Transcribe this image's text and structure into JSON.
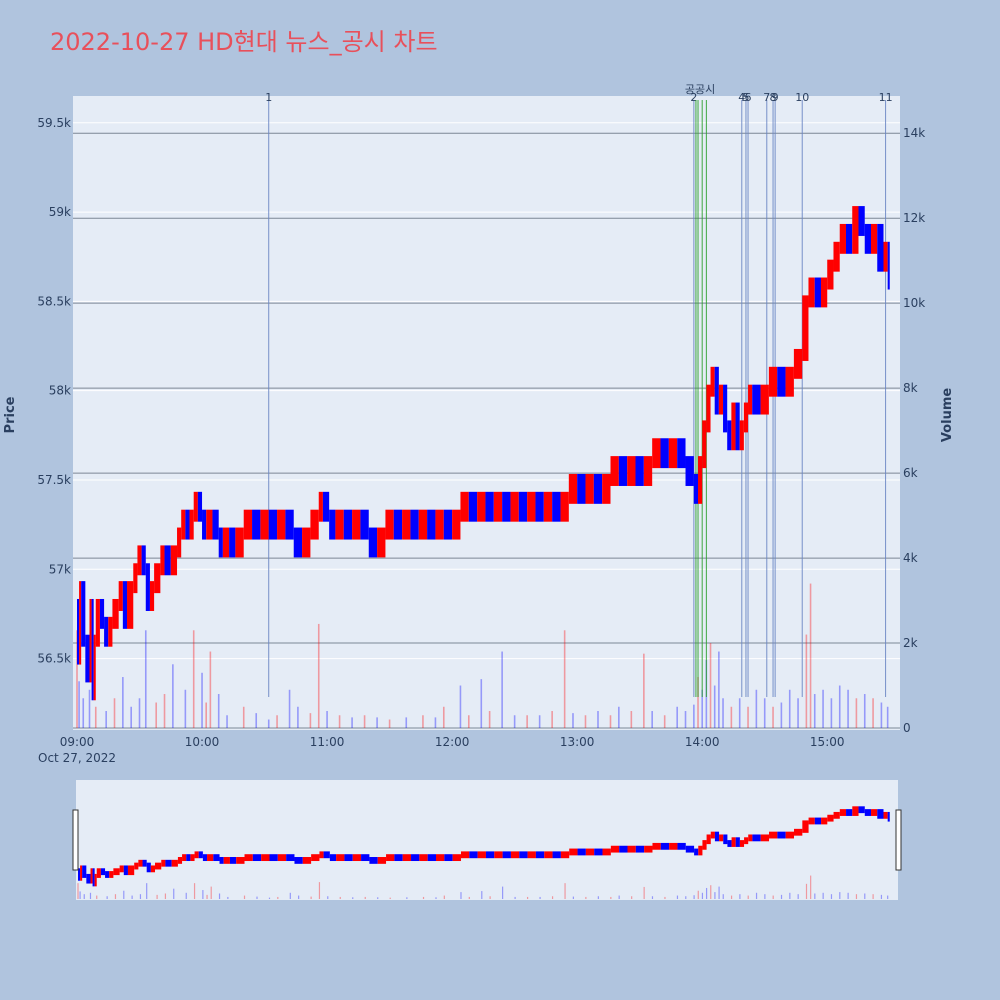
{
  "title": "2022-10-27 HD현대 뉴스_공시 차트",
  "colors": {
    "up": "#ff0000",
    "down": "#0000ff",
    "news_line": "#6a86c4",
    "disclosure_line": "#2ca02c",
    "background": "#b0c4de",
    "plot_bg": "#e5ecf6"
  },
  "chart_data": {
    "type": "candlestick",
    "yaxis_title": "Price",
    "y2axis_title": "Volume",
    "price_range": [
      56100,
      59650
    ],
    "volume_range": [
      0,
      14500
    ],
    "price_ticks": [
      {
        "v": 56500,
        "label": "56.5k"
      },
      {
        "v": 57000,
        "label": "57k"
      },
      {
        "v": 57500,
        "label": "57.5k"
      },
      {
        "v": 58000,
        "label": "58k"
      },
      {
        "v": 58500,
        "label": "58.5k"
      },
      {
        "v": 59000,
        "label": "59k"
      },
      {
        "v": 59500,
        "label": "59.5k"
      }
    ],
    "volume_ticks": [
      {
        "v": 0,
        "label": "0"
      },
      {
        "v": 2000,
        "label": "2k"
      },
      {
        "v": 4000,
        "label": "4k"
      },
      {
        "v": 6000,
        "label": "6k"
      },
      {
        "v": 8000,
        "label": "8k"
      },
      {
        "v": 10000,
        "label": "10k"
      },
      {
        "v": 12000,
        "label": "12k"
      },
      {
        "v": 14000,
        "label": "14k"
      }
    ],
    "x_ticks": [
      {
        "t": 0,
        "label": "09:00"
      },
      {
        "t": 60,
        "label": "10:00"
      },
      {
        "t": 120,
        "label": "11:00"
      },
      {
        "t": 180,
        "label": "12:00"
      },
      {
        "t": 240,
        "label": "13:00"
      },
      {
        "t": 300,
        "label": "14:00"
      },
      {
        "t": 360,
        "label": "15:00"
      }
    ],
    "x_range_minutes": [
      0,
      393
    ],
    "date_label": "Oct 27, 2022",
    "price_path": [
      [
        0,
        56800
      ],
      [
        1,
        56500
      ],
      [
        2,
        56900
      ],
      [
        4,
        56600
      ],
      [
        6,
        56400
      ],
      [
        7,
        56800
      ],
      [
        8,
        56300
      ],
      [
        9,
        56600
      ],
      [
        11,
        56800
      ],
      [
        13,
        56700
      ],
      [
        15,
        56600
      ],
      [
        17,
        56700
      ],
      [
        20,
        56800
      ],
      [
        22,
        56900
      ],
      [
        24,
        56700
      ],
      [
        27,
        56900
      ],
      [
        29,
        57000
      ],
      [
        31,
        57100
      ],
      [
        33,
        57000
      ],
      [
        35,
        56800
      ],
      [
        37,
        56900
      ],
      [
        40,
        57000
      ],
      [
        42,
        57100
      ],
      [
        45,
        57000
      ],
      [
        48,
        57100
      ],
      [
        50,
        57200
      ],
      [
        52,
        57300
      ],
      [
        54,
        57200
      ],
      [
        56,
        57300
      ],
      [
        58,
        57400
      ],
      [
        60,
        57300
      ],
      [
        62,
        57200
      ],
      [
        65,
        57300
      ],
      [
        68,
        57200
      ],
      [
        70,
        57100
      ],
      [
        73,
        57200
      ],
      [
        76,
        57100
      ],
      [
        80,
        57200
      ],
      [
        84,
        57300
      ],
      [
        88,
        57200
      ],
      [
        92,
        57300
      ],
      [
        96,
        57200
      ],
      [
        100,
        57300
      ],
      [
        104,
        57200
      ],
      [
        108,
        57100
      ],
      [
        112,
        57200
      ],
      [
        116,
        57300
      ],
      [
        118,
        57400
      ],
      [
        121,
        57300
      ],
      [
        124,
        57200
      ],
      [
        128,
        57300
      ],
      [
        132,
        57200
      ],
      [
        136,
        57300
      ],
      [
        140,
        57200
      ],
      [
        144,
        57100
      ],
      [
        148,
        57200
      ],
      [
        152,
        57300
      ],
      [
        156,
        57200
      ],
      [
        160,
        57300
      ],
      [
        164,
        57200
      ],
      [
        168,
        57300
      ],
      [
        172,
        57200
      ],
      [
        176,
        57300
      ],
      [
        180,
        57200
      ],
      [
        184,
        57300
      ],
      [
        188,
        57400
      ],
      [
        192,
        57300
      ],
      [
        196,
        57400
      ],
      [
        200,
        57300
      ],
      [
        204,
        57400
      ],
      [
        208,
        57300
      ],
      [
        212,
        57400
      ],
      [
        216,
        57300
      ],
      [
        220,
        57400
      ],
      [
        224,
        57300
      ],
      [
        228,
        57400
      ],
      [
        232,
        57300
      ],
      [
        236,
        57400
      ],
      [
        240,
        57500
      ],
      [
        244,
        57400
      ],
      [
        248,
        57500
      ],
      [
        252,
        57400
      ],
      [
        256,
        57500
      ],
      [
        260,
        57600
      ],
      [
        264,
        57500
      ],
      [
        268,
        57600
      ],
      [
        272,
        57500
      ],
      [
        276,
        57600
      ],
      [
        280,
        57700
      ],
      [
        284,
        57600
      ],
      [
        288,
        57700
      ],
      [
        292,
        57600
      ],
      [
        296,
        57500
      ],
      [
        298,
        57400
      ],
      [
        300,
        57600
      ],
      [
        302,
        57800
      ],
      [
        304,
        58000
      ],
      [
        306,
        58100
      ],
      [
        308,
        57900
      ],
      [
        310,
        58000
      ],
      [
        312,
        57800
      ],
      [
        314,
        57700
      ],
      [
        316,
        57900
      ],
      [
        318,
        57700
      ],
      [
        320,
        57800
      ],
      [
        322,
        57900
      ],
      [
        324,
        58000
      ],
      [
        328,
        57900
      ],
      [
        332,
        58000
      ],
      [
        336,
        58100
      ],
      [
        340,
        58000
      ],
      [
        344,
        58100
      ],
      [
        348,
        58200
      ],
      [
        351,
        58500
      ],
      [
        354,
        58600
      ],
      [
        357,
        58500
      ],
      [
        360,
        58600
      ],
      [
        363,
        58700
      ],
      [
        366,
        58800
      ],
      [
        369,
        58900
      ],
      [
        372,
        58800
      ],
      [
        375,
        59000
      ],
      [
        378,
        58900
      ],
      [
        381,
        58800
      ],
      [
        384,
        58900
      ],
      [
        387,
        58700
      ],
      [
        389,
        58800
      ],
      [
        390,
        58600
      ]
    ],
    "volume_bars": [
      [
        0,
        2300,
        "up"
      ],
      [
        1,
        1100,
        "down"
      ],
      [
        3,
        700,
        "down"
      ],
      [
        6,
        900,
        "down"
      ],
      [
        9,
        500,
        "up"
      ],
      [
        14,
        400,
        "down"
      ],
      [
        18,
        700,
        "up"
      ],
      [
        22,
        1200,
        "down"
      ],
      [
        26,
        500,
        "down"
      ],
      [
        30,
        700,
        "down"
      ],
      [
        33,
        2300,
        "down"
      ],
      [
        38,
        600,
        "up"
      ],
      [
        42,
        800,
        "up"
      ],
      [
        46,
        1500,
        "down"
      ],
      [
        52,
        900,
        "down"
      ],
      [
        56,
        2300,
        "up"
      ],
      [
        60,
        1300,
        "down"
      ],
      [
        62,
        600,
        "up"
      ],
      [
        64,
        1800,
        "up"
      ],
      [
        68,
        800,
        "down"
      ],
      [
        72,
        300,
        "down"
      ],
      [
        80,
        500,
        "up"
      ],
      [
        86,
        350,
        "down"
      ],
      [
        92,
        200,
        "down"
      ],
      [
        96,
        300,
        "up"
      ],
      [
        102,
        900,
        "down"
      ],
      [
        106,
        500,
        "down"
      ],
      [
        112,
        350,
        "up"
      ],
      [
        116,
        2450,
        "up"
      ],
      [
        120,
        400,
        "down"
      ],
      [
        126,
        300,
        "up"
      ],
      [
        132,
        250,
        "down"
      ],
      [
        138,
        300,
        "up"
      ],
      [
        144,
        250,
        "down"
      ],
      [
        150,
        200,
        "up"
      ],
      [
        158,
        250,
        "down"
      ],
      [
        166,
        300,
        "up"
      ],
      [
        172,
        250,
        "down"
      ],
      [
        176,
        500,
        "up"
      ],
      [
        184,
        1000,
        "down"
      ],
      [
        188,
        300,
        "up"
      ],
      [
        194,
        1150,
        "down"
      ],
      [
        198,
        400,
        "up"
      ],
      [
        204,
        1800,
        "down"
      ],
      [
        210,
        300,
        "down"
      ],
      [
        216,
        300,
        "up"
      ],
      [
        222,
        300,
        "down"
      ],
      [
        228,
        400,
        "up"
      ],
      [
        234,
        2300,
        "up"
      ],
      [
        238,
        350,
        "down"
      ],
      [
        244,
        300,
        "up"
      ],
      [
        250,
        400,
        "down"
      ],
      [
        256,
        300,
        "up"
      ],
      [
        260,
        500,
        "down"
      ],
      [
        266,
        400,
        "up"
      ],
      [
        272,
        1750,
        "up"
      ],
      [
        276,
        400,
        "down"
      ],
      [
        282,
        300,
        "up"
      ],
      [
        288,
        500,
        "down"
      ],
      [
        292,
        400,
        "down"
      ],
      [
        296,
        550,
        "down"
      ],
      [
        298,
        1200,
        "up"
      ],
      [
        300,
        900,
        "down"
      ],
      [
        302,
        1600,
        "down"
      ],
      [
        304,
        2000,
        "up"
      ],
      [
        306,
        1000,
        "down"
      ],
      [
        308,
        1800,
        "down"
      ],
      [
        310,
        700,
        "down"
      ],
      [
        314,
        500,
        "up"
      ],
      [
        318,
        700,
        "down"
      ],
      [
        322,
        500,
        "up"
      ],
      [
        326,
        900,
        "down"
      ],
      [
        330,
        700,
        "down"
      ],
      [
        334,
        500,
        "up"
      ],
      [
        338,
        600,
        "down"
      ],
      [
        342,
        900,
        "down"
      ],
      [
        346,
        700,
        "down"
      ],
      [
        350,
        2200,
        "up"
      ],
      [
        352,
        3400,
        "up"
      ],
      [
        354,
        800,
        "down"
      ],
      [
        358,
        900,
        "down"
      ],
      [
        362,
        700,
        "down"
      ],
      [
        366,
        1000,
        "down"
      ],
      [
        370,
        900,
        "down"
      ],
      [
        374,
        700,
        "up"
      ],
      [
        378,
        800,
        "down"
      ],
      [
        382,
        700,
        "up"
      ],
      [
        386,
        600,
        "down"
      ],
      [
        389,
        500,
        "down"
      ]
    ],
    "news_markers": [
      {
        "t": 92,
        "label": "1",
        "color": "news"
      },
      {
        "t": 296,
        "label": "2",
        "color": "news"
      },
      {
        "t": 297,
        "label": "",
        "color": "disclosure"
      },
      {
        "t": 298,
        "label": "",
        "color": "disclosure"
      },
      {
        "t": 300,
        "label": "",
        "color": "disclosure"
      },
      {
        "t": 302,
        "label": "",
        "color": "disclosure"
      },
      {
        "t": 319,
        "label": "4",
        "color": "news"
      },
      {
        "t": 321,
        "label": "5",
        "color": "news"
      },
      {
        "t": 322,
        "label": "6",
        "color": "news"
      },
      {
        "t": 331,
        "label": "7",
        "color": "news"
      },
      {
        "t": 334,
        "label": "8",
        "color": "news"
      },
      {
        "t": 335,
        "label": "9",
        "color": "news"
      },
      {
        "t": 348,
        "label": "10",
        "color": "news"
      },
      {
        "t": 388,
        "label": "11",
        "color": "news"
      }
    ],
    "disclosure_label": "공공시"
  }
}
